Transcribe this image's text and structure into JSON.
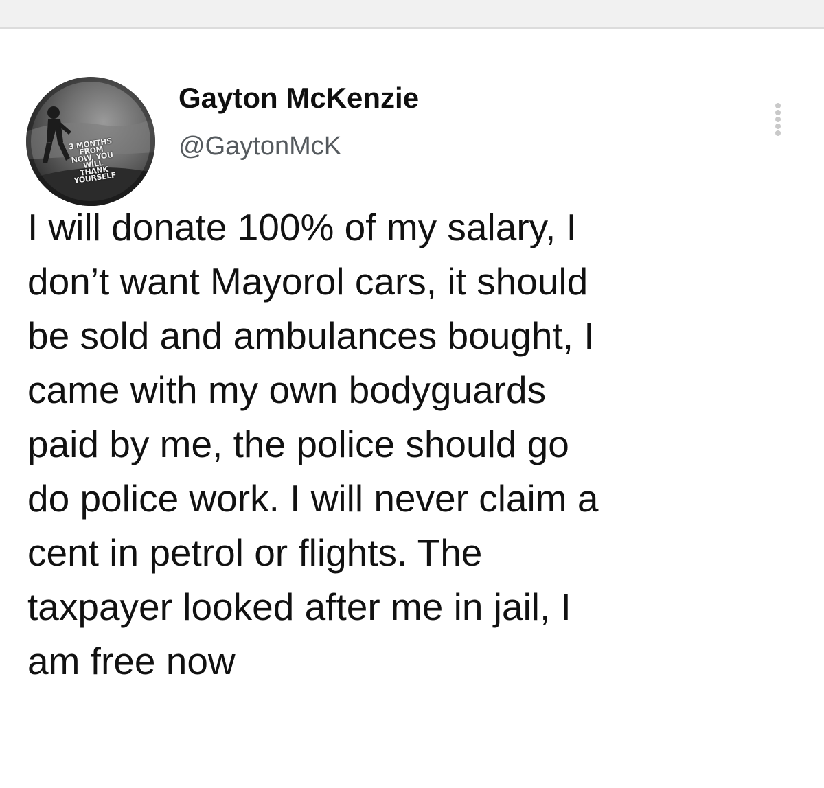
{
  "author": {
    "display_name": "Gayton McKenzie",
    "handle": "@GaytonMcK",
    "avatar_caption": "3 MONTHS FROM NOW, YOU WILL THANK YOURSELF"
  },
  "tweet": {
    "text": "I will donate 100% of my salary, I\ndon’t want Mayorol cars, it should\nbe sold and ambulances bought, I\ncame with my own bodyguards\npaid by me, the police should go\ndo police work. I will never claim a\ncent in petrol or flights. The\ntaxpayer looked after me in jail, I\nam free now"
  },
  "icons": {
    "more": "more-options-icon"
  },
  "colors": {
    "background": "#ffffff",
    "text": "#111111",
    "handle": "#555a5e"
  }
}
